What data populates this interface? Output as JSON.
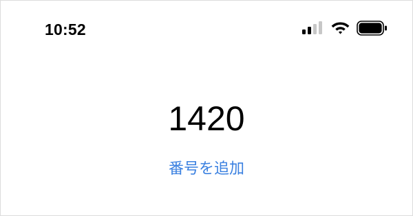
{
  "status_bar": {
    "time": "10:52",
    "signal_icon": "cellular-signal-icon",
    "wifi_icon": "wifi-icon",
    "battery_icon": "battery-icon",
    "signal_bars_filled": 2,
    "signal_bars_total": 4,
    "battery_level": 1.0
  },
  "dialer": {
    "number": "1420",
    "add_number_label": "番号を追加"
  },
  "colors": {
    "accent": "#3a80e0",
    "text": "#000000",
    "signal_inactive": "#c7c7c7",
    "border": "#dcdcdc"
  }
}
